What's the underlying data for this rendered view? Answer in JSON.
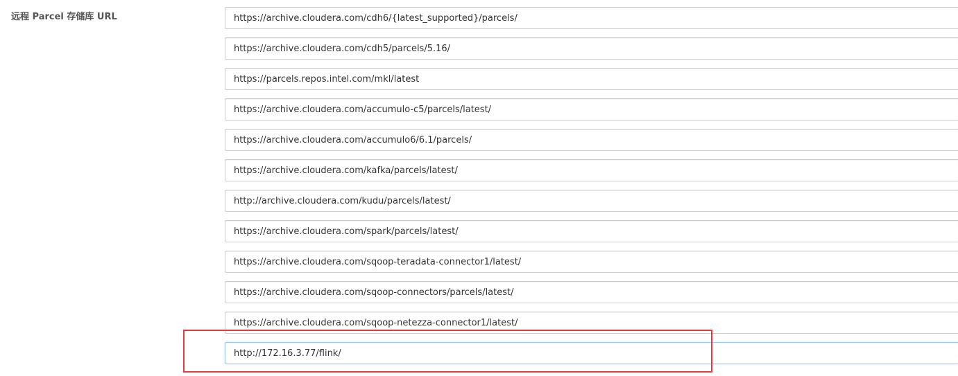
{
  "setting": {
    "label": "远程 Parcel 存储库 URL"
  },
  "urls": [
    "https://archive.cloudera.com/cdh6/{latest_supported}/parcels/",
    "https://archive.cloudera.com/cdh5/parcels/5.16/",
    "https://parcels.repos.intel.com/mkl/latest",
    "https://archive.cloudera.com/accumulo-c5/parcels/latest/",
    "https://archive.cloudera.com/accumulo6/6.1/parcels/",
    "https://archive.cloudera.com/kafka/parcels/latest/",
    "http://archive.cloudera.com/kudu/parcels/latest/",
    "https://archive.cloudera.com/spark/parcels/latest/",
    "https://archive.cloudera.com/sqoop-teradata-connector1/latest/",
    "https://archive.cloudera.com/sqoop-connectors/parcels/latest/",
    "https://archive.cloudera.com/sqoop-netezza-connector1/latest/",
    "http://172.16.3.77/flink/"
  ],
  "colors": {
    "highlight": "#e8393e",
    "active_border": "#9fcbe6"
  }
}
